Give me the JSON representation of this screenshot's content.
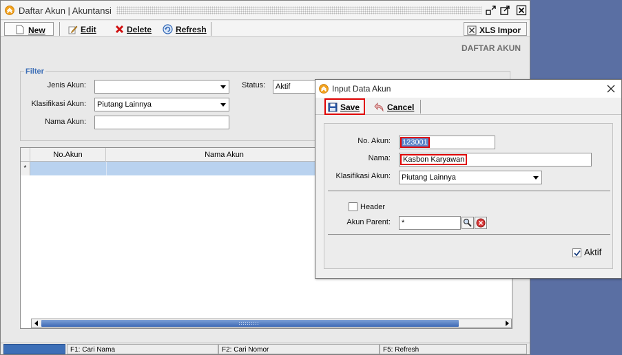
{
  "window": {
    "title": "Daftar Akun | Akuntansi"
  },
  "toolbar": {
    "new_label": "New",
    "edit_label": "Edit",
    "delete_label": "Delete",
    "refresh_label": "Refresh",
    "xls_label": "XLS Impor"
  },
  "section_title": "DAFTAR AKUN",
  "filter": {
    "legend": "Filter",
    "jenis_akun_label": "Jenis Akun:",
    "jenis_akun_value": "",
    "klasifikasi_label": "Klasifikasi Akun:",
    "klasifikasi_value": "Piutang Lainnya",
    "nama_akun_label": "Nama Akun:",
    "nama_akun_value": "",
    "status_label": "Status:",
    "status_value": "Aktif"
  },
  "grid": {
    "columns": [
      "No.Akun",
      "Nama Akun"
    ],
    "new_row_indicator": "*"
  },
  "statusbar": {
    "items": [
      "",
      "F1: Cari Nama",
      "F2: Cari Nomor",
      "F5: Refresh"
    ]
  },
  "dialog": {
    "title": "Input Data Akun",
    "save_label": "Save",
    "cancel_label": "Cancel",
    "no_akun_label": "No. Akun:",
    "no_akun_value": "123001",
    "nama_label": "Nama:",
    "nama_value": "Kasbon Karyawan",
    "klasifikasi_label": "Klasifikasi Akun:",
    "klasifikasi_value": "Piutang Lainnya",
    "header_label": "Header",
    "header_checked": false,
    "parent_label": "Akun Parent:",
    "parent_value": "*",
    "aktif_label": "Aktif",
    "aktif_checked": true
  },
  "icons": {
    "app_logo": "app-logo-icon",
    "new": "new-document-icon",
    "edit": "edit-pencil-icon",
    "delete": "delete-x-icon",
    "refresh": "refresh-icon",
    "xls": "xls-icon",
    "save": "floppy-disk-icon",
    "cancel": "undo-arrow-icon",
    "search": "magnifier-icon",
    "clear": "clear-red-icon"
  },
  "colors": {
    "desktop": "#5a6fa3",
    "accent_blue": "#3d6fb7",
    "selection_row": "#b9d2ef",
    "highlight_red": "#e00000"
  }
}
